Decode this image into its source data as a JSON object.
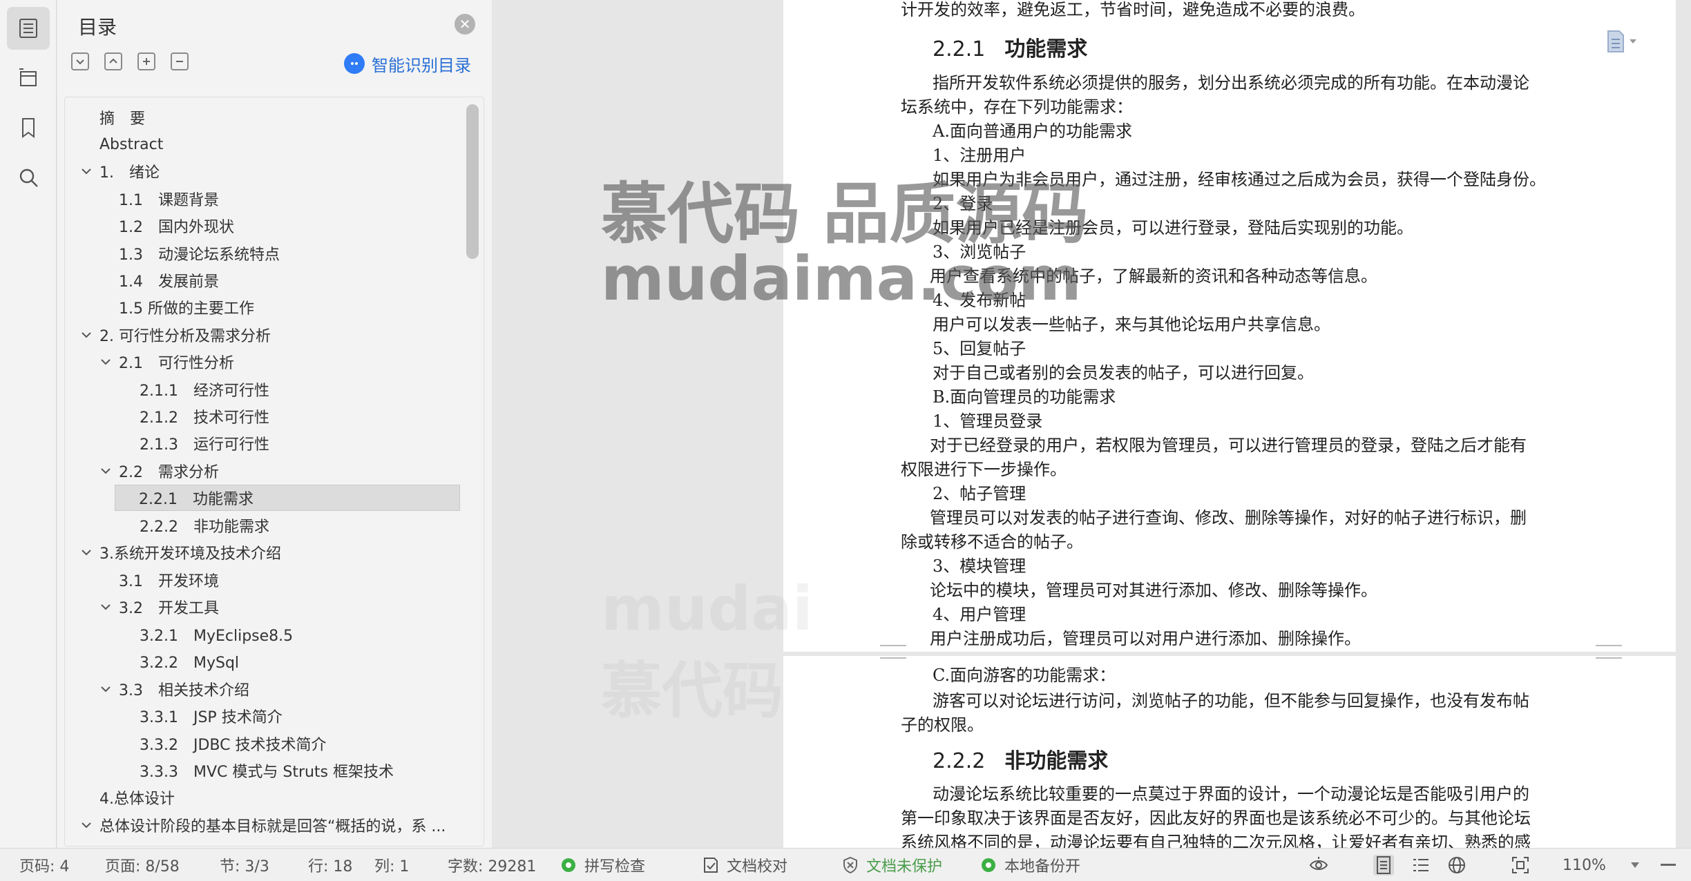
{
  "toc": {
    "title": "目录",
    "close_icon": "close-icon",
    "smart_label": "智能识别目录",
    "items": [
      {
        "label": "摘　要",
        "level": 0,
        "expand": false
      },
      {
        "label": "Abstract",
        "level": 0,
        "expand": false
      },
      {
        "label": "1.　绪论",
        "level": 0,
        "expand": true
      },
      {
        "label": "1.1　课题背景",
        "level": 1,
        "expand": false
      },
      {
        "label": "1.2　国内外现状",
        "level": 1,
        "expand": false
      },
      {
        "label": "1.3　动漫论坛系统特点",
        "level": 1,
        "expand": false
      },
      {
        "label": "1.4　发展前景",
        "level": 1,
        "expand": false
      },
      {
        "label": "1.5 所做的主要工作",
        "level": 1,
        "expand": false
      },
      {
        "label": "2.  可行性分析及需求分析",
        "level": 0,
        "expand": true
      },
      {
        "label": "2.1　可行性分析",
        "level": 1,
        "expand": true
      },
      {
        "label": "2.1.1　经济可行性",
        "level": 2,
        "expand": false
      },
      {
        "label": "2.1.2　技术可行性",
        "level": 2,
        "expand": false
      },
      {
        "label": "2.1.3　运行可行性",
        "level": 2,
        "expand": false
      },
      {
        "label": "2.2　需求分析",
        "level": 1,
        "expand": true
      },
      {
        "label": "2.2.1　功能需求",
        "level": 2,
        "expand": false,
        "selected": true
      },
      {
        "label": "2.2.2　非功能需求",
        "level": 2,
        "expand": false
      },
      {
        "label": "3.系统开发环境及技术介绍",
        "level": 0,
        "expand": true
      },
      {
        "label": "3.1　开发环境",
        "level": 1,
        "expand": false
      },
      {
        "label": "3.2　开发工具",
        "level": 1,
        "expand": true
      },
      {
        "label": "3.2.1　MyEclipse8.5",
        "level": 2,
        "expand": false
      },
      {
        "label": "3.2.2　MySql",
        "level": 2,
        "expand": false
      },
      {
        "label": "3.3　相关技术介绍",
        "level": 1,
        "expand": true
      },
      {
        "label": "3.3.1　JSP 技术简介",
        "level": 2,
        "expand": false
      },
      {
        "label": "3.3.2　JDBC 技术技术简介",
        "level": 2,
        "expand": false
      },
      {
        "label": "3.3.3　MVC 模式与 Struts 框架技术",
        "level": 2,
        "expand": false
      },
      {
        "label": "4.总体设计",
        "level": 0,
        "expand": false
      },
      {
        "label": "总体设计阶段的基本目标就是回答“概括的说，系 ...",
        "level": 0,
        "expand": true
      }
    ]
  },
  "document": {
    "top_cut": "计开发的效率，避免返工，节省时间，避免造成不必要的浪费。",
    "h_221_num": "2.2.1",
    "h_221_title": "功能需求",
    "p1": "指所开发软件系统必须提供的服务，划分出系统必须完成的所有功能。在本动漫论",
    "p1b": "坛系统中，存在下列功能需求：",
    "a_title": "A.面向普通用户的功能需求",
    "a1": "1、注册用户",
    "a1d": "如果用户为非会员用户，通过注册，经审核通过之后成为会员，获得一个登陆身份。",
    "a2": "2、登录",
    "a2d": "如果用户已经是注册会员，可以进行登录，登陆后实现别的功能。",
    "a3": "3、浏览帖子",
    "a3d": "用户查看系统中的帖子，了解最新的资讯和各种动态等信息。",
    "a4": "4、发布新帖",
    "a4d": "用户可以发表一些帖子，来与其他论坛用户共享信息。",
    "a5": "5、回复帖子",
    "a5d": "对于自己或者别的会员发表的帖子，可以进行回复。",
    "b_title": "B.面向管理员的功能需求",
    "b1": "1、管理员登录",
    "b1d": "对于已经登录的用户，若权限为管理员，可以进行管理员的登录，登陆之后才能有",
    "b1d2": "权限进行下一步操作。",
    "b2": "2、帖子管理",
    "b2d": "管理员可以对发表的帖子进行查询、修改、删除等操作，对好的帖子进行标识，删",
    "b2d2": "除或转移不适合的帖子。",
    "b3": "3、模块管理",
    "b3d": "论坛中的模块，管理员可对其进行添加、修改、删除等操作。",
    "b4": "4、用户管理",
    "b4d": "用户注册成功后，管理员可以对用户进行添加、删除操作。",
    "c_title": "C.面向游客的功能需求：",
    "c1d": "游客可以对论坛进行访问，浏览帖子的功能，但不能参与回复操作，也没有发布帖",
    "c1d2": "子的权限。",
    "h_222_num": "2.2.2",
    "h_222_title": "非功能需求",
    "n1": "动漫论坛系统比较重要的一点莫过于界面的设计，一个动漫论坛是否能吸引用户的",
    "n2": "第一印象取决于该界面是否友好，因此友好的界面也是该系统必不可少的。与其他论坛",
    "n3": "系统风格不同的是，动漫论坛要有自己独特的二次元风格，让爱好者有亲切、熟悉的感"
  },
  "watermark": {
    "line1": "慕代码 品质源码",
    "line2": "mudaima.com",
    "faint1": "mudai",
    "faint2": "慕代码"
  },
  "status": {
    "page_code": "页码: 4",
    "page": "页面: 8/58",
    "section": "节: 3/3",
    "row": "行: 18",
    "col": "列: 1",
    "words": "字数: 29281",
    "spell": "拼写检查",
    "proof": "文档校对",
    "protect": "文档未保护",
    "backup": "本地备份开",
    "zoom": "110%"
  },
  "colors": {
    "accent": "#2f7cf6",
    "green": "#3cb043",
    "protect_green": "#4a9d4a"
  }
}
